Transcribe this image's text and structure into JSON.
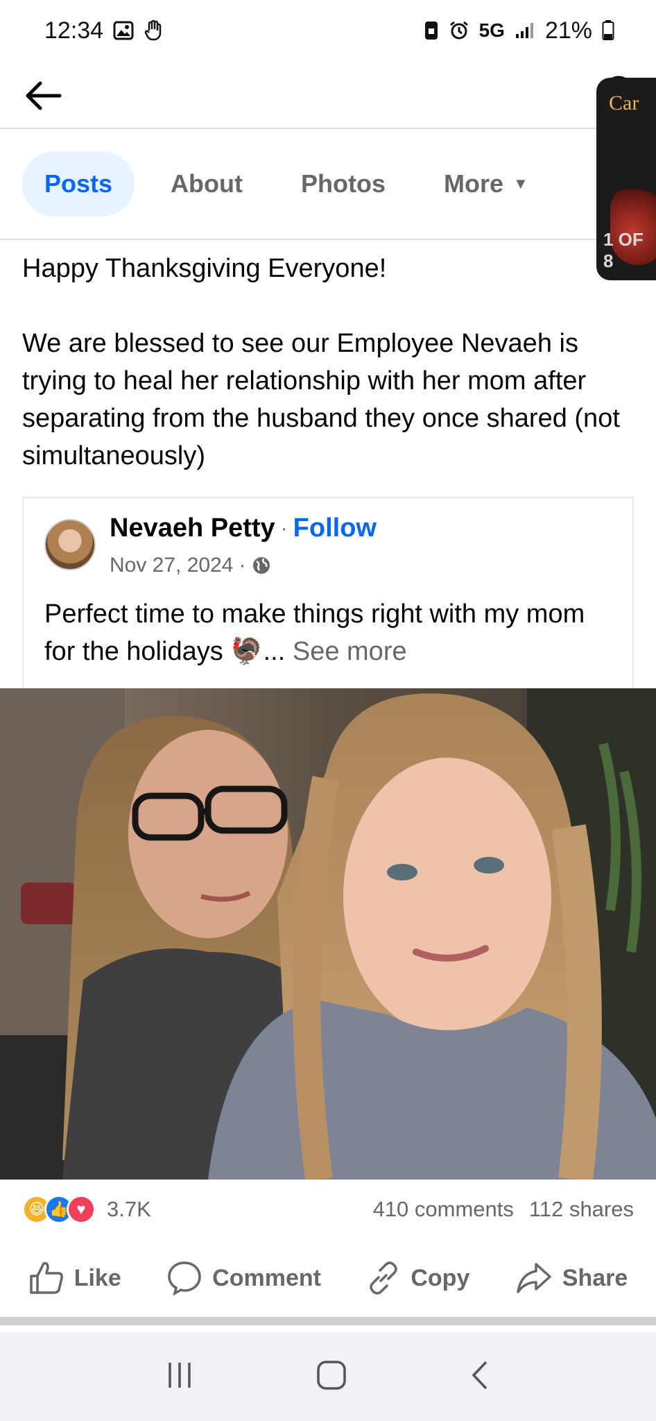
{
  "status_bar": {
    "time": "12:34",
    "network": "5G",
    "battery": "21%"
  },
  "header": {
    "back_icon": "arrow-left-icon",
    "search_icon": "search-icon"
  },
  "tabs": [
    {
      "label": "Posts",
      "active": true
    },
    {
      "label": "About",
      "active": false
    },
    {
      "label": "Photos",
      "active": false
    },
    {
      "label": "More",
      "active": false
    }
  ],
  "pip": {
    "top_text": "Car",
    "counter": "1 OF 8"
  },
  "post": {
    "line1": "Happy Thanksgiving Everyone!",
    "body": "We are blessed to see our Employee Nevaeh is trying to heal her relationship with her mom after separating from the husband they once shared (not simultaneously)"
  },
  "shared_post": {
    "author": "Nevaeh Petty",
    "separator": "·",
    "follow_label": "Follow",
    "date": "Nov 27, 2024",
    "text": "Perfect time to make things right with my mom for the holidays",
    "emoji": "🦃",
    "ellipsis": "...",
    "see_more": "See more"
  },
  "engagement": {
    "reaction_count": "3.7K",
    "comments": "410 comments",
    "shares": "112 shares"
  },
  "actions": {
    "like": "Like",
    "comment": "Comment",
    "copy": "Copy",
    "share": "Share"
  },
  "colors": {
    "accent": "#0866ff",
    "muted": "#65676b",
    "active_tab_bg": "#e7f3ff"
  }
}
